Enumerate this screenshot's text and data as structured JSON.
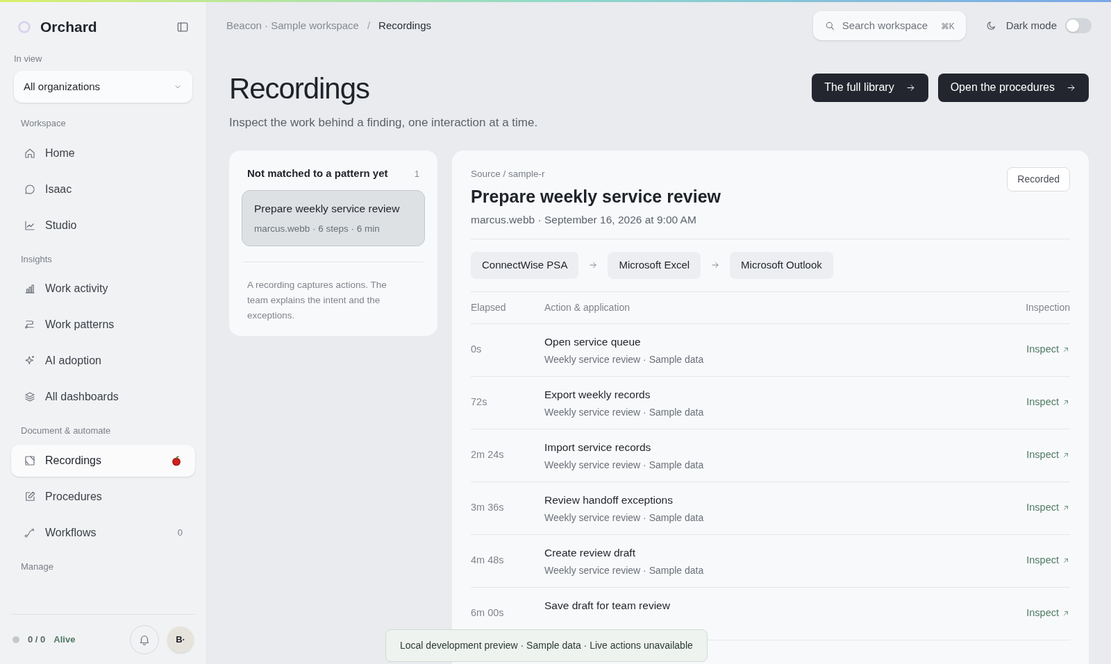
{
  "sidebar": {
    "brand": "Orchard",
    "scope_label": "In view",
    "scope_value": "All organizations",
    "sections": [
      {
        "title": "Workspace",
        "items": [
          {
            "label": "Home",
            "selected": false
          },
          {
            "label": "Isaac",
            "selected": false
          },
          {
            "label": "Studio",
            "selected": false
          }
        ]
      },
      {
        "title": "Insights",
        "items": [
          {
            "label": "Work activity",
            "selected": false
          },
          {
            "label": "Work patterns",
            "selected": false
          },
          {
            "label": "AI adoption",
            "selected": false
          },
          {
            "label": "All dashboards",
            "selected": false
          }
        ]
      },
      {
        "title": "Document & automate",
        "items": [
          {
            "label": "Recordings",
            "selected": true,
            "flagged": true
          },
          {
            "label": "Procedures",
            "selected": false
          },
          {
            "label": "Workflows",
            "selected": false,
            "count": "0"
          }
        ]
      },
      {
        "title": "Manage"
      }
    ],
    "footer": {
      "count": "0 / 0",
      "status": "Alive",
      "avatar": "B·"
    }
  },
  "header": {
    "breadcrumb": [
      "Beacon · Sample workspace",
      "Recordings"
    ],
    "breadcrumb_separator": "/",
    "search": {
      "placeholder": "Search workspace",
      "shortcut": "⌘K"
    },
    "dark_mode": {
      "label": "Dark mode",
      "on": false
    }
  },
  "page": {
    "title": "Recordings",
    "subtitle": "Inspect the work behind a finding, one interaction at a time.",
    "buttons": [
      "The full library",
      "Open the procedures"
    ]
  },
  "list": {
    "title": "Not matched to a pattern yet",
    "count": "1",
    "items": [
      {
        "title": "Prepare weekly service review",
        "meta": "marcus.webb · 6 steps · 6 min",
        "selected": true
      }
    ],
    "note": "A recording captures actions. The team explains the intent and the exceptions."
  },
  "detail": {
    "source": "Source / sample-r",
    "title": "Prepare weekly service review",
    "meta": "marcus.webb · September 16, 2026 at 9:00 AM",
    "status": "Recorded",
    "apps": [
      "ConnectWise PSA",
      "Microsoft Excel",
      "Microsoft Outlook"
    ],
    "columns": [
      "Elapsed",
      "Action & application",
      "Inspection"
    ],
    "rows": [
      {
        "elapsed": "0s",
        "action": "Open service queue",
        "context": "Weekly service review · Sample data",
        "link": "Inspect"
      },
      {
        "elapsed": "72s",
        "action": "Export weekly records",
        "context": "Weekly service review · Sample data",
        "link": "Inspect"
      },
      {
        "elapsed": "2m 24s",
        "action": "Import service records",
        "context": "Weekly service review · Sample data",
        "link": "Inspect"
      },
      {
        "elapsed": "3m 36s",
        "action": "Review handoff exceptions",
        "context": "Weekly service review · Sample data",
        "link": "Inspect"
      },
      {
        "elapsed": "4m 48s",
        "action": "Create review draft",
        "context": "Weekly service review · Sample data",
        "link": "Inspect"
      },
      {
        "elapsed": "6m 00s",
        "action": "Save draft for team review",
        "link": "Inspect"
      }
    ]
  },
  "toast": "Local development preview · Sample data · Live actions unavailable"
}
